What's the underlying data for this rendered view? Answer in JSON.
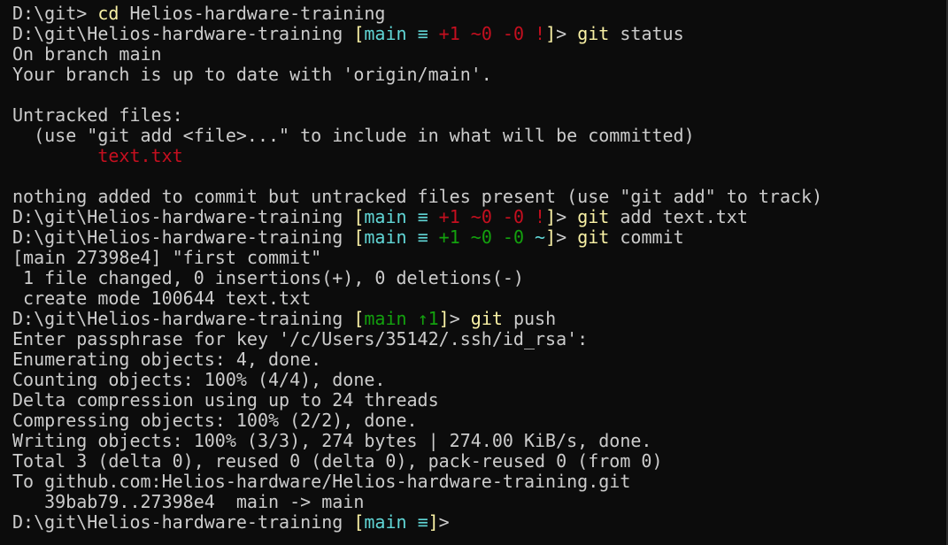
{
  "colors": {
    "fg": "#cccccc",
    "yellow": "#f9f1a5",
    "cyan": "#61d6d6",
    "red": "#c50f1f",
    "green": "#13a10e",
    "background": "#0c0c0c"
  },
  "lines": [
    [
      {
        "t": "D:\\git> ",
        "c": "fg"
      },
      {
        "t": "cd",
        "c": "yellow"
      },
      {
        "t": " Helios-hardware-training",
        "c": "fg"
      }
    ],
    [
      {
        "t": "D:\\git\\Helios-hardware-training ",
        "c": "fg"
      },
      {
        "t": "[",
        "c": "yellow"
      },
      {
        "t": "main ≡ ",
        "c": "cyan"
      },
      {
        "t": "+1 ~0 -0 !",
        "c": "red"
      },
      {
        "t": "]",
        "c": "yellow"
      },
      {
        "t": "> ",
        "c": "fg"
      },
      {
        "t": "git",
        "c": "yellow"
      },
      {
        "t": " status",
        "c": "fg"
      }
    ],
    [
      {
        "t": "On branch main",
        "c": "fg"
      }
    ],
    [
      {
        "t": "Your branch is up to date with 'origin/main'.",
        "c": "fg"
      }
    ],
    [
      {
        "t": "",
        "c": "fg"
      }
    ],
    [
      {
        "t": "Untracked files:",
        "c": "fg"
      }
    ],
    [
      {
        "t": "  (use \"git add <file>...\" to include in what will be committed)",
        "c": "fg"
      }
    ],
    [
      {
        "t": "        ",
        "c": "fg"
      },
      {
        "t": "text.txt",
        "c": "red"
      }
    ],
    [
      {
        "t": "",
        "c": "fg"
      }
    ],
    [
      {
        "t": "nothing added to commit but untracked files present (use \"git add\" to track)",
        "c": "fg"
      }
    ],
    [
      {
        "t": "D:\\git\\Helios-hardware-training ",
        "c": "fg"
      },
      {
        "t": "[",
        "c": "yellow"
      },
      {
        "t": "main ≡ ",
        "c": "cyan"
      },
      {
        "t": "+1 ~0 -0 !",
        "c": "red"
      },
      {
        "t": "]",
        "c": "yellow"
      },
      {
        "t": "> ",
        "c": "fg"
      },
      {
        "t": "git",
        "c": "yellow"
      },
      {
        "t": " add text.txt",
        "c": "fg"
      }
    ],
    [
      {
        "t": "D:\\git\\Helios-hardware-training ",
        "c": "fg"
      },
      {
        "t": "[",
        "c": "yellow"
      },
      {
        "t": "main ≡ ",
        "c": "cyan"
      },
      {
        "t": "+1 ~0 -0 ",
        "c": "green"
      },
      {
        "t": "~",
        "c": "cyan"
      },
      {
        "t": "]",
        "c": "yellow"
      },
      {
        "t": "> ",
        "c": "fg"
      },
      {
        "t": "git",
        "c": "yellow"
      },
      {
        "t": " commit",
        "c": "fg"
      }
    ],
    [
      {
        "t": "[main 27398e4] \"first commit\"",
        "c": "fg"
      }
    ],
    [
      {
        "t": " 1 file changed, 0 insertions(+), 0 deletions(-)",
        "c": "fg"
      }
    ],
    [
      {
        "t": " create mode 100644 text.txt",
        "c": "fg"
      }
    ],
    [
      {
        "t": "D:\\git\\Helios-hardware-training ",
        "c": "fg"
      },
      {
        "t": "[",
        "c": "yellow"
      },
      {
        "t": "main ↑1",
        "c": "green"
      },
      {
        "t": "]",
        "c": "yellow"
      },
      {
        "t": "> ",
        "c": "fg"
      },
      {
        "t": "git",
        "c": "yellow"
      },
      {
        "t": " push",
        "c": "fg"
      }
    ],
    [
      {
        "t": "Enter passphrase for key '/c/Users/35142/.ssh/id_rsa':",
        "c": "fg"
      }
    ],
    [
      {
        "t": "Enumerating objects: 4, done.",
        "c": "fg"
      }
    ],
    [
      {
        "t": "Counting objects: 100% (4/4), done.",
        "c": "fg"
      }
    ],
    [
      {
        "t": "Delta compression using up to 24 threads",
        "c": "fg"
      }
    ],
    [
      {
        "t": "Compressing objects: 100% (2/2), done.",
        "c": "fg"
      }
    ],
    [
      {
        "t": "Writing objects: 100% (3/3), 274 bytes | 274.00 KiB/s, done.",
        "c": "fg"
      }
    ],
    [
      {
        "t": "Total 3 (delta 0), reused 0 (delta 0), pack-reused 0 (from 0)",
        "c": "fg"
      }
    ],
    [
      {
        "t": "To github.com:Helios-hardware/Helios-hardware-training.git",
        "c": "fg"
      }
    ],
    [
      {
        "t": "   39bab79..27398e4  main -> main",
        "c": "fg"
      }
    ],
    [
      {
        "t": "D:\\git\\Helios-hardware-training ",
        "c": "fg"
      },
      {
        "t": "[",
        "c": "yellow"
      },
      {
        "t": "main ≡",
        "c": "cyan"
      },
      {
        "t": "]",
        "c": "yellow"
      },
      {
        "t": ">",
        "c": "fg"
      }
    ]
  ]
}
